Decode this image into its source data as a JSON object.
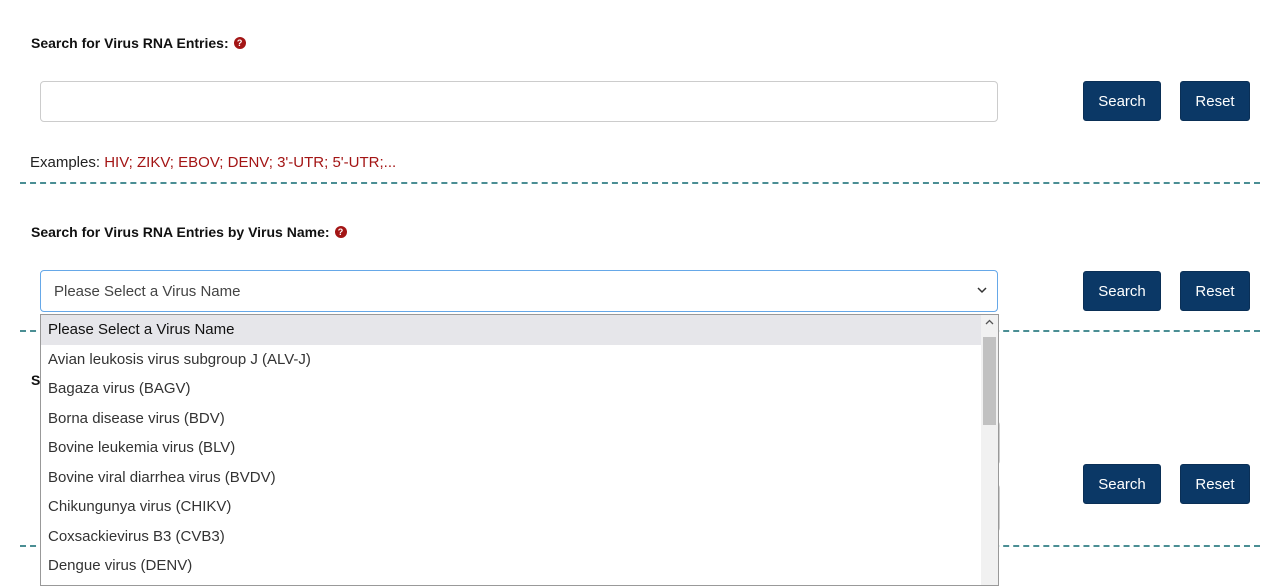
{
  "section1": {
    "title": "Search for Virus RNA Entries:",
    "help_glyph": "?",
    "input_value": "",
    "search_label": "Search",
    "reset_label": "Reset",
    "examples_label": "Examples:",
    "examples": [
      "HIV",
      "ZIKV",
      "EBOV",
      "DENV",
      "3'-UTR",
      "5'-UTR",
      "..."
    ]
  },
  "section2": {
    "title": "Search for Virus RNA Entries by Virus Name:",
    "help_glyph": "?",
    "selected_value": "Please Select a Virus Name",
    "search_label": "Search",
    "reset_label": "Reset",
    "options": [
      "Please Select a Virus Name",
      "Avian leukosis virus subgroup J (ALV-J)",
      "Bagaza virus (BAGV)",
      "Borna disease virus (BDV)",
      "Bovine leukemia virus (BLV)",
      "Bovine viral diarrhea virus (BVDV)",
      "Chikungunya virus (CHIKV)",
      "Coxsackievirus B3 (CVB3)",
      "Dengue virus (DENV)"
    ]
  },
  "section3": {
    "title_partial": "S",
    "search_label": "Search",
    "reset_label": "Reset"
  },
  "colors": {
    "button_bg": "#0b3866",
    "link_red": "#a31515",
    "dash_teal": "#4a8e94",
    "focus_border": "#66a8e8"
  }
}
